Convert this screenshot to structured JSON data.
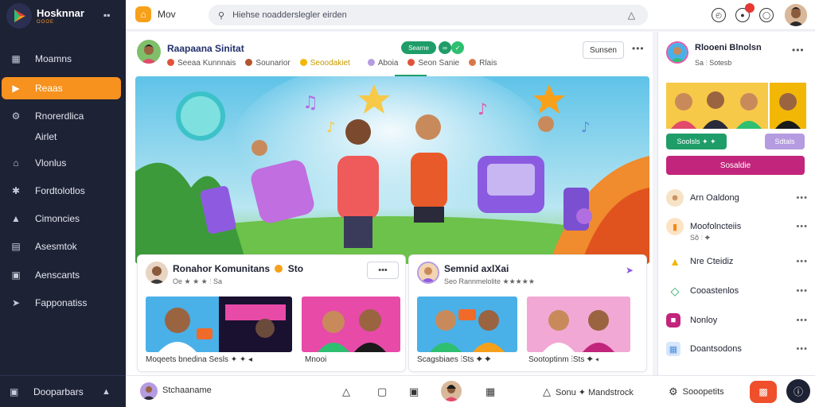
{
  "sidebar": {
    "brand_name": "Hosknnar",
    "brand_sub": "OOOE",
    "items": [
      {
        "label": "Moamns",
        "icon": "chart-bar-icon"
      },
      {
        "label": "Reaas",
        "icon": "play-icon"
      },
      {
        "label": "Rnorerdlica",
        "label2": "Airlet",
        "icon": "gear-icon"
      },
      {
        "label": "Vlonlus",
        "icon": "home-icon"
      },
      {
        "label": "Fordtolotlos",
        "icon": "wrench-icon"
      },
      {
        "label": "Cimoncies",
        "icon": "bell-icon"
      },
      {
        "label": "Asesmtok",
        "icon": "chart-line-icon"
      },
      {
        "label": "Aenscants",
        "icon": "lock-icon"
      },
      {
        "label": "Fapponatiss",
        "icon": "megaphone-icon"
      }
    ],
    "footer_label": "Dooparbars"
  },
  "topbar": {
    "home_label": "Mov",
    "search_placeholder": "Hiehse noadderslegler eirden"
  },
  "post": {
    "author": "Raapaana Sinitat",
    "meta": [
      "Seeaa Kunnnais",
      "Sounarior",
      "Seoodakiet",
      "Aboia",
      "Seon Sanie",
      "Rlais"
    ],
    "pill": "Searne",
    "save": "Sunsen"
  },
  "cards": [
    {
      "title": "Ronahor Komunitans",
      "badge": "Sto",
      "sub": "Oe ★ ★ ★ ⫶ Sa",
      "caption1": "Moqeets bnedina Sesls ✦ ✦ ◂",
      "caption2": "Mnooi"
    },
    {
      "title": "Semnid axlXai",
      "sub": "Seo Rannmelolite ★★★★★",
      "caption1": "Scagsbiaes ⫶Sts ✦ ✦",
      "caption2": "Sootoptinm ⫶Sts ✦ ◂"
    }
  ],
  "right": {
    "name": "Rlooeni Blnolsn",
    "meta": "Sa ⫶ Sotesb",
    "green_btn": "Soolsls ✦ ✦",
    "lilac_btn": "Sdtals",
    "magenta_btn": "Sosaldie",
    "rows": [
      {
        "label": "Arn Oaldong",
        "icon": "user-icon",
        "color": "#e9a23b"
      },
      {
        "label": "Moofolncteiis",
        "sub": "Sõ ⫶ ✦",
        "icon": "folder-icon",
        "color": "#f28c18"
      },
      {
        "label": "Nre Cteidiz",
        "icon": "warning-icon",
        "color": "#f2b705"
      },
      {
        "label": "Cooastenlos",
        "icon": "diamond-icon",
        "color": "#1f9d69"
      },
      {
        "label": "Nonloy",
        "icon": "square-icon",
        "color": "#c2257c"
      },
      {
        "label": "Doantsodons",
        "icon": "grid-icon",
        "color": "#4a90e2"
      }
    ]
  },
  "bottombar": {
    "left_label": "Stchaaname",
    "mid_label": "Sonu ✦ Mandstrock",
    "right_label": "Sooopetits"
  }
}
